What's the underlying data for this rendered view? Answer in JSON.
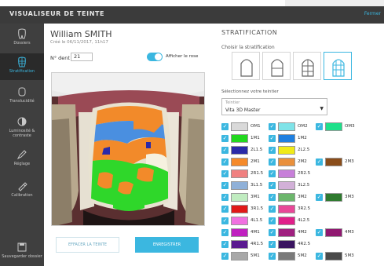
{
  "app": {
    "title": "VISUALISEUR DE TEINTE",
    "header_link": "Fermer"
  },
  "sidebar": [
    {
      "label": "Dossiers",
      "icon": "tooth-icon",
      "active": false
    },
    {
      "label": "Stratification",
      "icon": "grid-tooth-icon",
      "active": true
    },
    {
      "label": "Translucidité",
      "icon": "tooth-outline-icon",
      "active": false
    },
    {
      "label": "Luminosité & contraste",
      "icon": "contrast-icon",
      "active": false
    },
    {
      "label": "Réglage",
      "icon": "pencil-icon",
      "active": false
    },
    {
      "label": "Calibration",
      "icon": "eyedropper-icon",
      "active": false
    },
    {
      "label": "Sauvegarder dossier",
      "icon": "save-icon",
      "active": false
    }
  ],
  "patient": {
    "name": "William SMITH",
    "subtitle": "Créé le 06/11/2017, 11h17"
  },
  "tooth": {
    "label": "N° dent",
    "value": "21"
  },
  "toggle": {
    "label": "Afficher le rose",
    "on": true
  },
  "buttons": {
    "clear": "EFFACER LA TEINTE",
    "save": "ENREGISTRER"
  },
  "stratification": {
    "title": "STRATIFICATION",
    "choose_label": "Choisir la stratification",
    "options": [
      {
        "name": "strat-single",
        "selected": false
      },
      {
        "name": "strat-horizontal",
        "selected": false
      },
      {
        "name": "strat-grid",
        "selected": false
      },
      {
        "name": "strat-detailed",
        "selected": true
      }
    ],
    "select_label": "Sélectionnez votre teintier",
    "select_placeholder": "Teintier",
    "select_value": "Vita 3D Master"
  },
  "swatches": [
    [
      {
        "name": "OM1",
        "color": "#d9d9d9"
      },
      {
        "name": "OM2",
        "color": "#7fe3e8"
      },
      {
        "name": "OM3",
        "color": "#1ee08a"
      }
    ],
    [
      {
        "name": "1M1",
        "color": "#22d81e"
      },
      {
        "name": "1M2",
        "color": "#1f7fe0"
      }
    ],
    [
      {
        "name": "2L1.5",
        "color": "#2a2aa8"
      },
      {
        "name": "2L2.5",
        "color": "#f0ea18"
      }
    ],
    [
      {
        "name": "2M1",
        "color": "#f58a2a"
      },
      {
        "name": "2M2",
        "color": "#e9903c"
      },
      {
        "name": "2M3",
        "color": "#8a4d1a"
      }
    ],
    [
      {
        "name": "2R1.5",
        "color": "#f08080"
      },
      {
        "name": "2R2.5",
        "color": "#c77fd9"
      }
    ],
    [
      {
        "name": "3L1.5",
        "color": "#8fb0d8"
      },
      {
        "name": "3L2.5",
        "color": "#d2b0d8"
      }
    ],
    [
      {
        "name": "3M1",
        "color": "#c0ecc0"
      },
      {
        "name": "3M2",
        "color": "#6cb66c"
      },
      {
        "name": "3M3",
        "color": "#2e7a2e"
      }
    ],
    [
      {
        "name": "3R1.5",
        "color": "#e01818"
      },
      {
        "name": "3R2.5",
        "color": "#e84898"
      }
    ],
    [
      {
        "name": "4L1.5",
        "color": "#f070e0"
      },
      {
        "name": "4L2.5",
        "color": "#e0208a"
      }
    ],
    [
      {
        "name": "4M1",
        "color": "#c020c0"
      },
      {
        "name": "4M2",
        "color": "#a02080"
      },
      {
        "name": "4M3",
        "color": "#901870"
      }
    ],
    [
      {
        "name": "4R1.5",
        "color": "#5a1a90"
      },
      {
        "name": "4R2.5",
        "color": "#3a1460"
      }
    ],
    [
      {
        "name": "5M1",
        "color": "#a8a8a8"
      },
      {
        "name": "5M2",
        "color": "#7a7a7a"
      },
      {
        "name": "5M3",
        "color": "#4a4a4a"
      }
    ]
  ],
  "colors": {
    "accent": "#3bb7e0",
    "titlebar": "#3b3b3b",
    "sidebar": "#3f3f3f"
  }
}
